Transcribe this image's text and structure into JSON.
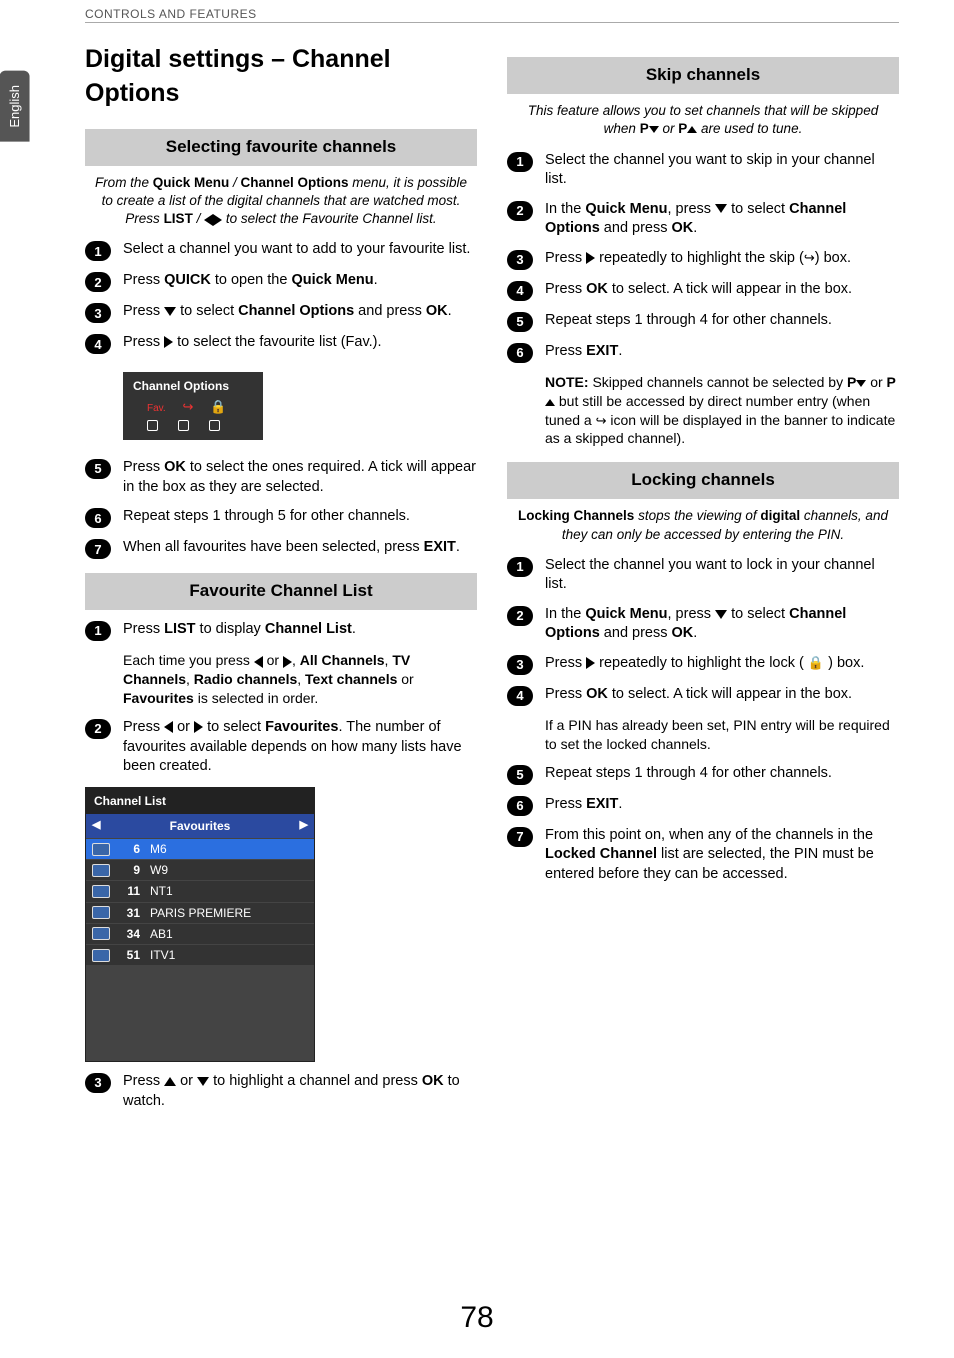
{
  "header": {
    "section": "CONTROLS AND FEATURES",
    "lang_tab": "English"
  },
  "page_number": "78",
  "left": {
    "h1": "Digital settings – Channel Options",
    "sec1": {
      "title": "Selecting favourite channels",
      "intro_pre": "From the ",
      "intro_b1": "Quick Menu",
      "intro_slash": " / ",
      "intro_b2": "Channel Options",
      "intro_mid": " menu, it is possible to create a list of the digital channels that are watched most. Press ",
      "intro_b3": "LIST",
      "intro_tail": " to select the Favourite Channel list.",
      "s1": "Select a channel you want to add to your favourite list.",
      "s2a": "Press ",
      "s2b": "QUICK",
      "s2c": " to open the ",
      "s2d": "Quick Menu",
      "s2e": ".",
      "s3a": "Press ",
      "s3b": " to select ",
      "s3c": "Channel Options",
      "s3d": " and press ",
      "s3e": "OK",
      "s3f": ".",
      "s4a": "Press ",
      "s4b": " to select the favourite list (Fav.).",
      "cobox_title": "Channel Options",
      "cobox_fav": "Fav.",
      "s5a": "Press ",
      "s5b": "OK",
      "s5c": " to select the ones required. A tick will appear in the box as they are selected.",
      "s6": "Repeat steps 1 through 5 for other channels.",
      "s7a": "When all favourites have been selected, press ",
      "s7b": "EXIT",
      "s7c": "."
    },
    "sec2": {
      "title": "Favourite Channel List",
      "s1a": "Press ",
      "s1b": "LIST",
      "s1c": " to display ",
      "s1d": "Channel List",
      "s1e": ".",
      "sub_a": "Each time you press ",
      "sub_b": " or ",
      "sub_c": "All Channels",
      "sub_d": "TV Channels",
      "sub_e": "Radio channels",
      "sub_f": "Text channels",
      "sub_g": " or ",
      "sub_h": "Favourites",
      "sub_i": " is selected in order.",
      "s2a": "Press ",
      "s2b": " or ",
      "s2c": " to select ",
      "s2d": "Favourites",
      "s2e": ". The number of favourites available depends on how many lists have been created.",
      "list_title": "Channel List",
      "list_sub": "Favourites",
      "rows": [
        {
          "n": "6",
          "name": "M6"
        },
        {
          "n": "9",
          "name": "W9"
        },
        {
          "n": "11",
          "name": "NT1"
        },
        {
          "n": "31",
          "name": "PARIS PREMIERE"
        },
        {
          "n": "34",
          "name": "AB1"
        },
        {
          "n": "51",
          "name": "ITV1"
        }
      ],
      "s3a": "Press ",
      "s3b": " or ",
      "s3c": " to highlight a channel and press ",
      "s3d": "OK",
      "s3e": " to watch."
    }
  },
  "right": {
    "sec1": {
      "title": "Skip channels",
      "intro_a": "This feature allows you to set channels that will be skipped when ",
      "intro_b": " or ",
      "intro_c": " are used to tune.",
      "s1": "Select the channel you want to skip in your channel list.",
      "s2a": "In the ",
      "s2b": "Quick Menu",
      "s2c": ", press ",
      "s2d": " to select ",
      "s2e": "Channel Options",
      "s2f": " and press ",
      "s2g": "OK",
      "s2h": ".",
      "s3a": "Press ",
      "s3b": " repeatedly to highlight the skip (",
      "s3c": ") box.",
      "s4a": "Press ",
      "s4b": "OK",
      "s4c": " to select. A tick will appear in the box.",
      "s5": "Repeat steps 1 through 4 for other channels.",
      "s6a": "Press ",
      "s6b": "EXIT",
      "s6c": ".",
      "note_a": "NOTE:",
      "note_b": " Skipped channels cannot be selected by ",
      "note_c": " or ",
      "note_d": " but still be accessed by direct number entry (when tuned a ",
      "note_e": " icon will be displayed in the banner to indicate as a skipped channel)."
    },
    "sec2": {
      "title": "Locking channels",
      "intro_a": "Locking Channels",
      "intro_b": " stops the viewing of ",
      "intro_c": "digital",
      "intro_d": " channels, and they can only be accessed by entering the PIN.",
      "s1": "Select the channel you want to lock in your channel list.",
      "s2a": "In the ",
      "s2b": "Quick Menu",
      "s2c": ", press ",
      "s2d": " to select ",
      "s2e": "Channel Options",
      "s2f": " and press ",
      "s2g": "OK",
      "s2h": ".",
      "s3a": "Press ",
      "s3b": " repeatedly to highlight the lock ( ",
      "s3c": " ) box.",
      "s4a": "Press ",
      "s4b": "OK",
      "s4c": " to select. A tick will appear in the box.",
      "sub4": "If a PIN has already been set, PIN entry will be required to set the locked channels.",
      "s5": "Repeat steps 1 through 4 for other channels.",
      "s6a": "Press ",
      "s6b": "EXIT",
      "s6c": ".",
      "s7a": "From this point on, when any of the channels in the ",
      "s7b": "Locked Channel",
      "s7c": " list are selected, the PIN must be entered before they can be accessed."
    }
  }
}
